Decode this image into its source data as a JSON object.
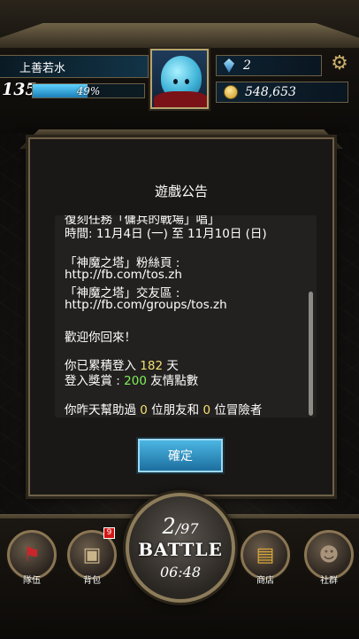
{
  "player": {
    "name": "上善若水",
    "level": "135",
    "exp_percent": "49%",
    "exp_fraction": 0.49
  },
  "resources": {
    "gems": "2",
    "coins": "548,653"
  },
  "dialog": {
    "title": "遊戲公告",
    "lines": {
      "l0": "復刻任務「傭兵的戰場」唱」",
      "l1": "時間: 11月4日 (一) 至 11月10日 (日)",
      "l2": "「神魔之塔」粉絲頁 :",
      "l3": "http://fb.com/tos.zh",
      "l4": "「神魔之塔」交友區 :",
      "l5": "http://fb.com/groups/tos.zh",
      "l6": "歡迎你回來！",
      "l7a": "你已累積登入 ",
      "l7b": "182",
      "l7c": " 天",
      "l8a": "登入獎賞 : ",
      "l8b": "200",
      "l8c": " 友情點數",
      "l9a": "你昨天幫助過 ",
      "l9b": "0",
      "l9c": " 位朋友和 ",
      "l9d": "0",
      "l9e": " 位冒險者"
    },
    "confirm_label": "確定"
  },
  "nav": {
    "team": "隊伍",
    "backpack": "背包",
    "backpack_badge": "9",
    "shop": "商店",
    "community": "社群"
  },
  "battle": {
    "stamina_current": "2",
    "stamina_max": "/97",
    "label": "BATTLE",
    "timer": "06:48"
  },
  "colors": {
    "highlight_yellow": "#f3e071",
    "highlight_green": "#7ef05b",
    "confirm_blue": "#2f93c6"
  }
}
